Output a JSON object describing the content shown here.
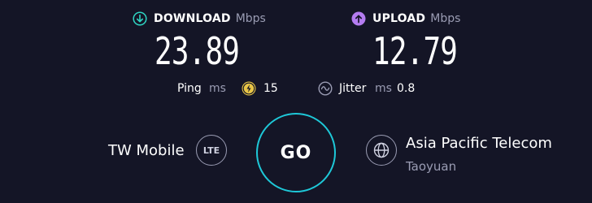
{
  "download": {
    "label": "DOWNLOAD",
    "unit": "Mbps",
    "value": "23.89",
    "icon": "download-arrow-icon",
    "color": "#2fd6c4"
  },
  "upload": {
    "label": "UPLOAD",
    "unit": "Mbps",
    "value": "12.79",
    "icon": "upload-arrow-icon",
    "color": "#b47cf0"
  },
  "ping": {
    "label": "Ping",
    "unit": "ms",
    "value": "15",
    "icon": "ping-bolt-icon",
    "color": "#e8c547"
  },
  "jitter": {
    "label": "Jitter",
    "unit": "ms",
    "value": "0.8",
    "icon": "jitter-wave-icon"
  },
  "go_button": {
    "label": "GO",
    "accent": "#1ec8d8"
  },
  "provider": {
    "name": "TW Mobile",
    "badge": "LTE"
  },
  "server": {
    "name": "Asia Pacific Telecom",
    "location": "Taoyuan",
    "icon": "globe-icon"
  }
}
